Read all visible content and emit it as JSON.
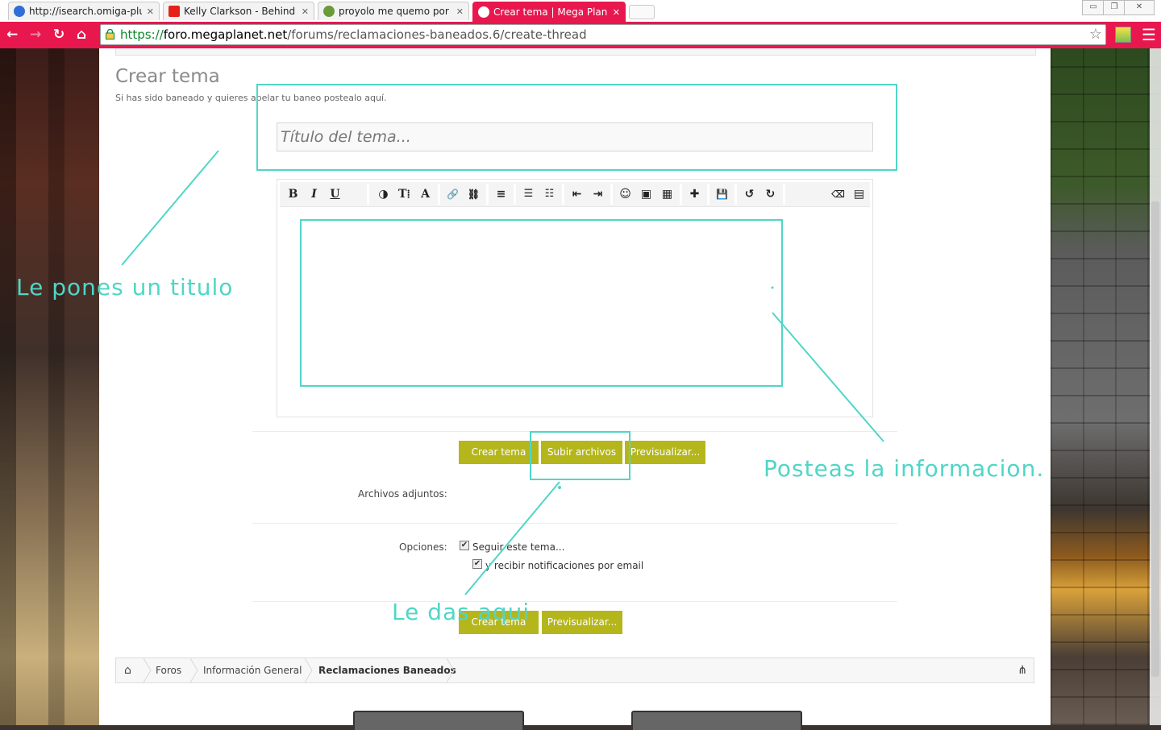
{
  "browser": {
    "tabs": [
      {
        "title": "http://isearch.omiga-plus",
        "favicon_color": "#2d6fd6"
      },
      {
        "title": "Kelly Clarkson - Behind Th",
        "favicon_color": "#e62117"
      },
      {
        "title": "proyolo me quemo por te",
        "favicon_color": "#6a9a3a"
      },
      {
        "title": "Crear tema | Mega Planet",
        "favicon_color": "#ffffff",
        "active": true
      }
    ],
    "close_glyph": "✕",
    "url_scheme": "https://",
    "url_host": "foro.megaplanet.net",
    "url_path": "/forums/reclamaciones-baneados.6/create-thread",
    "accent_color": "#e8174e"
  },
  "page": {
    "title": "Crear tema",
    "subtitle": "Si has sido baneado y quieres apelar tu baneo postealo aquí.",
    "title_input_placeholder": "Título del tema...",
    "toolbar": {
      "bold": "B",
      "italic": "I",
      "underline": "U",
      "color": "◑",
      "size": "T⁞",
      "font": "A",
      "link": "🔗",
      "unlink": "⛓",
      "align": "≡",
      "bullets": "☰",
      "numbers": "☷",
      "outdent": "⇤",
      "indent": "⇥",
      "smilie": "☺",
      "image": "▣",
      "media": "▦",
      "insert": "✚",
      "save": "💾",
      "undo": "↺",
      "redo": "↻",
      "remove_format": "⌫",
      "toggle_source": "▤"
    },
    "buttons": {
      "create": "Crear tema",
      "upload": "Subir archivos",
      "preview": "Previsualizar..."
    },
    "attachments_label": "Archivos adjuntos:",
    "options_label": "Opciones:",
    "option_watch": "Seguir este tema...",
    "option_email": "y recibir notificaciones por email",
    "checkmark": "✔",
    "button_color": "#b5b61c",
    "breadcrumb": {
      "home_icon": "⌂",
      "items": [
        "Foros",
        "Información General",
        "Reclamaciones Baneados"
      ],
      "sitemap_icon": "⋔"
    }
  },
  "annotations": {
    "title_note": "Le pones un titulo",
    "body_note": "Posteas la informacion.",
    "button_note": "Le das aqui",
    "color": "#4fd6c6"
  }
}
